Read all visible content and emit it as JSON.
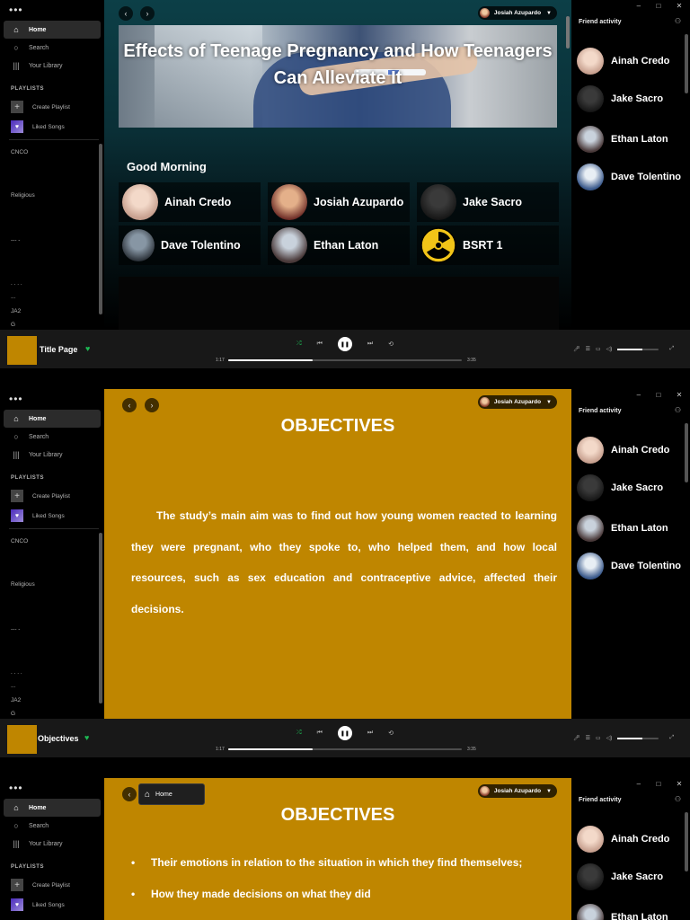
{
  "colors": {
    "accent_green": "#1db954",
    "slide_gold": "#bf8600",
    "banner_teal": "#0c3f47"
  },
  "sidebar": {
    "nav": [
      {
        "label": "Home",
        "icon": "home-icon"
      },
      {
        "label": "Search",
        "icon": "search-icon"
      },
      {
        "label": "Your Library",
        "icon": "library-icon"
      }
    ],
    "playlists_header": "PLAYLISTS",
    "create_playlist": "Create Playlist",
    "liked_songs": "Liked Songs",
    "playlists": [
      "CNCO",
      "Religious",
      "--- -",
      ". . . .",
      "...",
      "JA2",
      "G"
    ]
  },
  "header": {
    "user_name": "Josiah Azupardo"
  },
  "home": {
    "banner_title": "Effects of Teenage Pregnancy and How Teenagers Can Alleviate It",
    "greeting": "Good Morning",
    "cards": [
      "Ainah Credo",
      "Josiah Azupardo",
      "Jake Sacro",
      "Dave Tolentino",
      "Ethan Laton",
      "BSRT 1"
    ]
  },
  "slide2": {
    "title": "OBJECTIVES",
    "paragraph": "The study’s main aim was to find out how young women reacted to learning they were pregnant, who they spoke to, who helped them, and how local resources, such as sex education and contraceptive advice, affected their decisions."
  },
  "slide3": {
    "title": "OBJECTIVES",
    "tooltip": "Home",
    "bullets": [
      "Their emotions in relation to the situation in which they find themselves;",
      "How they made decisions on what they did"
    ]
  },
  "friend_activity": {
    "title": "Friend activity",
    "friends": [
      "Ainah Credo",
      "Jake Sacro",
      "Ethan Laton",
      "Dave Tolentino"
    ]
  },
  "player1": {
    "now_playing": "Title Page",
    "elapsed": "1:17",
    "total": "3:35",
    "progress": 0.36,
    "volume": 0.6
  },
  "player2": {
    "now_playing": "Objectives",
    "elapsed": "1:17",
    "total": "3:35",
    "progress": 0.36,
    "volume": 0.6
  }
}
